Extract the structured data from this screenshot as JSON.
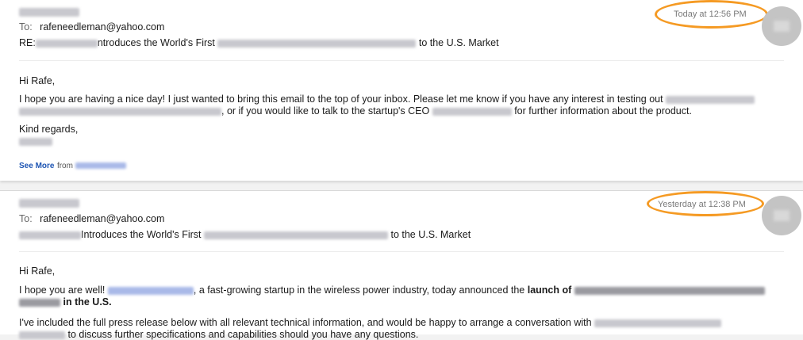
{
  "email1": {
    "to_label": "To:",
    "to_address": "rafeneedleman@yahoo.com",
    "subject_prefix": "RE:",
    "subject_mid": "ntroduces the World's First",
    "subject_end": "to the U.S. Market",
    "timestamp": "Today at 12:56 PM",
    "greeting": "Hi Rafe,",
    "body_line1": "I hope you are having a nice day! I just wanted to bring this email to the top of your inbox. Please let me know if you have any interest in testing out",
    "body_line2a": ", or if you would like to talk to the startup's CEO",
    "body_line2b": "for further information about the product.",
    "signoff": "Kind regards,",
    "see_more": "See More",
    "from_label": "from"
  },
  "email2": {
    "to_label": "To:",
    "to_address": "rafeneedleman@yahoo.com",
    "subject_mid": "Introduces the World's First",
    "subject_end": "to the U.S. Market",
    "timestamp": "Yesterday at 12:38 PM",
    "greeting": "Hi Rafe,",
    "body_line1a": "I hope you are well!",
    "body_line1b": ", a fast-growing startup in the wireless power industry, today announced the",
    "body_line1_bold": "launch of",
    "body_line2_bold": "in the U.S.",
    "body_line3": "I've included the full press release below with all relevant technical information, and would be happy to arrange a conversation with",
    "body_line4": "to discuss further specifications and capabilities should you have any questions."
  },
  "colors": {
    "annotation_ring": "#f59a23",
    "link_blue": "#1e55b3"
  }
}
